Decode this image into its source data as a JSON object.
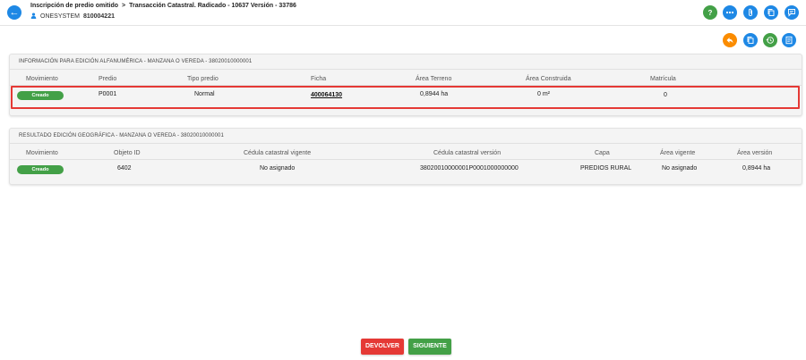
{
  "header": {
    "crumb1": "Inscripción de predio omitido",
    "crumb_separator": ">",
    "crumb2": "Transacción Catastral. Radicado - 10637 Versión - 33786",
    "user_name": "ONESYSTEM",
    "user_id": "810004221"
  },
  "header_icons": [
    {
      "name": "help-icon",
      "color": "#43a047"
    },
    {
      "name": "more-icon",
      "color": "#1e88e5"
    },
    {
      "name": "attachment-icon",
      "color": "#1e88e5"
    },
    {
      "name": "copy-icon",
      "color": "#1e88e5"
    },
    {
      "name": "comment-icon",
      "color": "#1e88e5"
    }
  ],
  "action_icons": [
    {
      "name": "reply-icon",
      "color": "#fb8c00"
    },
    {
      "name": "copy-icon",
      "color": "#1e88e5"
    },
    {
      "name": "history-icon",
      "color": "#43a047"
    },
    {
      "name": "document-icon",
      "color": "#1e88e5"
    }
  ],
  "panel1": {
    "title": "INFORMACIÓN PARA EDICIÓN ALFANUMÉRICA - MANZANA O VEREDA - 38020010000001",
    "headers": [
      "Movimiento",
      "Predio",
      "Tipo predio",
      "Ficha",
      "Área Terreno",
      "Área Construida",
      "Matrícula"
    ],
    "row": {
      "movimiento": "Creado",
      "predio": "P0001",
      "tipo_predio": "Normal",
      "ficha": "400064130",
      "area_terreno": "0,8944 ha",
      "area_construida": "0 m²",
      "matricula": "0"
    }
  },
  "panel2": {
    "title": "RESULTADO EDICIÓN GEOGRÁFICA - MANZANA O VEREDA - 38020010000001",
    "headers": [
      "Movimiento",
      "Objeto ID",
      "Cédula catastral vigente",
      "Cédula catastral versión",
      "Capa",
      "Área vigente",
      "Área versión"
    ],
    "row": {
      "movimiento": "Creado",
      "objeto_id": "6402",
      "cedula_vigente": "No asignado",
      "cedula_version": "38020010000001P0001000000000",
      "capa": "PREDIOS RURAL",
      "area_vigente": "No asignado",
      "area_version": "0,8944 ha"
    }
  },
  "footer": {
    "devolver": "DEVOLVER",
    "siguiente": "SIGUIENTE"
  },
  "colors": {
    "primary": "#1e88e5",
    "success": "#43a047",
    "danger": "#e53935",
    "warning": "#fb8c00"
  }
}
